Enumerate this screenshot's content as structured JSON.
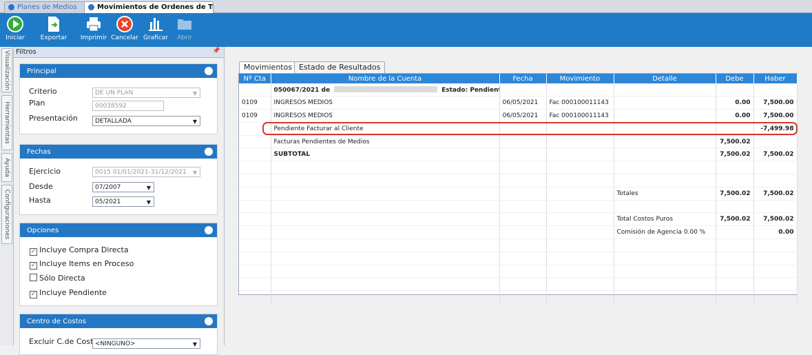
{
  "window_tabs": [
    "Planes de Medios",
    "Movimientos de Ordenes de Tra..."
  ],
  "toolbar": [
    {
      "label": "Iniciar",
      "icon": "play-icon"
    },
    {
      "label": "Exportar",
      "icon": "export-icon"
    },
    {
      "label": "Imprimir",
      "icon": "printer-icon"
    },
    {
      "label": "Cancelar",
      "icon": "cancel-icon"
    },
    {
      "label": "Graficar",
      "icon": "chart-icon"
    },
    {
      "label": "Abrir",
      "icon": "folder-icon"
    }
  ],
  "side_tabs": [
    "Visualización",
    "Herramientas",
    "Ayuda",
    "Configuraciones"
  ],
  "filters": {
    "title": "Filtros",
    "principal": {
      "title": "Principal",
      "criterio_label": "Criterio",
      "criterio_value": "DE UN PLAN",
      "plan_label": "Plan",
      "plan_value": "00038592",
      "presentacion_label": "Presentación",
      "presentacion_value": "DETALLADA"
    },
    "fechas": {
      "title": "Fechas",
      "ejercicio_label": "Ejercicio",
      "ejercicio_value": "0015 01/01/2021-31/12/2021",
      "desde_label": "Desde",
      "desde_value": "07/2007",
      "hasta_label": "Hasta",
      "hasta_value": "05/2021"
    },
    "opciones": {
      "title": "Opciones",
      "items": [
        {
          "label": "Incluye Compra Directa",
          "checked": true
        },
        {
          "label": "Incluye Items en Proceso",
          "checked": true
        },
        {
          "label": "Sólo Directa",
          "checked": false
        },
        {
          "label": "Incluye Pendiente",
          "checked": true
        }
      ]
    },
    "centro": {
      "title": "Centro de Costos",
      "excluir_label": "Excluir C.de Costo",
      "excluir_value": "<NINGUNO>"
    }
  },
  "main_tabs": [
    "Movimientos",
    "Estado de Resultados"
  ],
  "table": {
    "headers": [
      "Nº Cta",
      "Nombre de la Cuenta",
      "Fecha",
      "Movimiento",
      "Detalle",
      "Debe",
      "Haber"
    ],
    "header_row": {
      "order": "050067/2021 de",
      "estado": "Estado: Pendiente"
    },
    "rows": [
      [
        "0109",
        "INGRESOS MEDIOS",
        "06/05/2021",
        "Fac 000100011143",
        "",
        "0.00",
        "7,500.00"
      ],
      [
        "0109",
        "INGRESOS MEDIOS",
        "06/05/2021",
        "Fac 000100011143",
        "",
        "0.00",
        "7,500.00"
      ],
      [
        "",
        "Pendiente Facturar al Cliente",
        "",
        "",
        "",
        "",
        "-7,499.98"
      ],
      [
        "",
        "Facturas Pendientes de Medios",
        "",
        "",
        "",
        "7,500.02",
        ""
      ],
      [
        "",
        "SUBTOTAL",
        "",
        "",
        "",
        "7,500.02",
        "7,500.02"
      ],
      [
        "",
        "",
        "",
        "",
        "",
        "",
        ""
      ],
      [
        "",
        "",
        "",
        "",
        "",
        "",
        ""
      ],
      [
        "",
        "",
        "",
        "",
        "Totales",
        "7,500.02",
        "7,500.02"
      ],
      [
        "",
        "",
        "",
        "",
        "",
        "",
        ""
      ],
      [
        "",
        "",
        "",
        "",
        "Total Costos Puros",
        "7,500.02",
        "7,500.02"
      ],
      [
        "",
        "",
        "",
        "",
        "Comisión de Agencia 0.00 %",
        "",
        "0.00"
      ],
      [
        "",
        "",
        "",
        "",
        "",
        "",
        ""
      ],
      [
        "",
        "",
        "",
        "",
        "",
        "",
        ""
      ],
      [
        "",
        "",
        "",
        "",
        "",
        "",
        ""
      ],
      [
        "",
        "",
        "",
        "",
        "",
        "",
        ""
      ],
      [
        "",
        "",
        "",
        "",
        "",
        "",
        ""
      ]
    ]
  },
  "colors": {
    "ribbon": "#1f7bc7",
    "section_header": "#2477c3",
    "grid_header": "#2d86d6",
    "highlight": "#d9362a"
  }
}
